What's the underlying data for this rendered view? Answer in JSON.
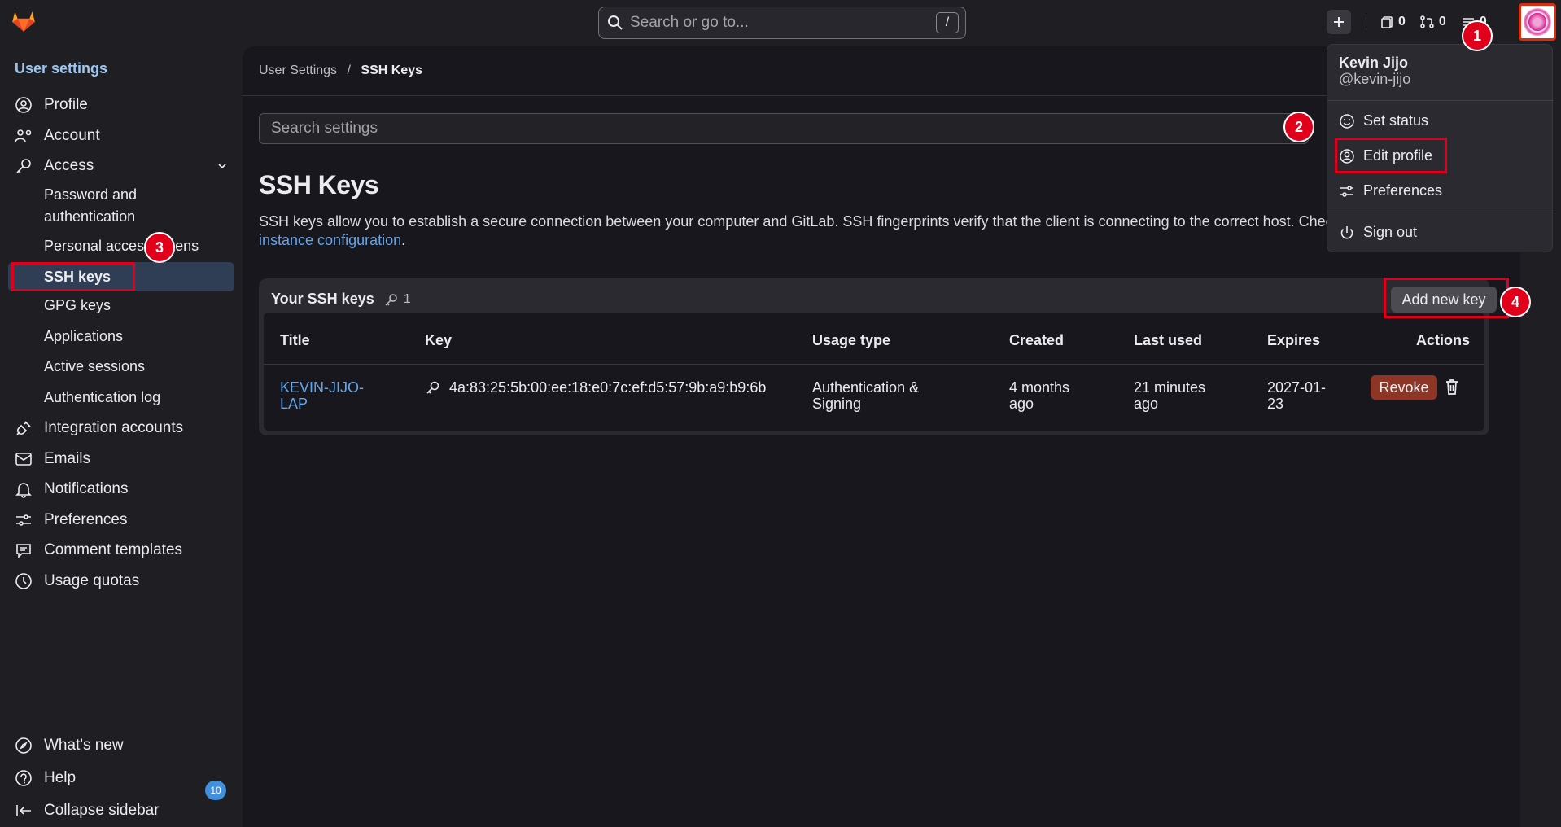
{
  "header": {
    "search_placeholder": "Search or go to...",
    "search_shortcut": "/",
    "issues_count": "0",
    "merge_requests_count": "0",
    "todos_count": "0"
  },
  "sidebar": {
    "title": "User settings",
    "items": [
      {
        "label": "Profile",
        "icon": "profile-icon"
      },
      {
        "label": "Account",
        "icon": "account-icon"
      },
      {
        "label": "Access",
        "icon": "key-icon"
      },
      {
        "label": "Integration accounts",
        "icon": "plug-icon"
      },
      {
        "label": "Emails",
        "icon": "mail-icon"
      },
      {
        "label": "Notifications",
        "icon": "bell-icon"
      },
      {
        "label": "Preferences",
        "icon": "preferences-icon"
      },
      {
        "label": "Comment templates",
        "icon": "comment-icon"
      },
      {
        "label": "Usage quotas",
        "icon": "quota-icon"
      }
    ],
    "access_sub": {
      "password": "Password and authentication",
      "pat": "Personal access tokens",
      "ssh": "SSH keys",
      "gpg": "GPG keys",
      "applications": "Applications",
      "sessions": "Active sessions",
      "auth_log": "Authentication log"
    },
    "footer": {
      "whats_new": "What's new",
      "whats_new_count": "10",
      "help": "Help",
      "collapse": "Collapse sidebar"
    }
  },
  "main": {
    "breadcrumb_parent": "User Settings",
    "breadcrumb_sep": "/",
    "breadcrumb_current": "SSH Keys",
    "search_placeholder": "Search settings",
    "title": "SSH Keys",
    "description": "SSH keys allow you to establish a secure connection between your computer and GitLab. SSH fingerprints verify that the client is connecting to the correct host. Check the current instance configuration.",
    "description_link": "instance configuration",
    "description_end": ".",
    "card": {
      "title": "Your SSH keys",
      "count": "1",
      "add_button": "Add new key",
      "headers": [
        "Title",
        "Key",
        "Usage type",
        "Created",
        "Last used",
        "Expires",
        "Actions"
      ],
      "row": {
        "title_line1": "KEVIN-JIJO-",
        "title_line2": "LAP",
        "key": "4a:83:25:5b:00:ee:18:e0:7c:ef:d5:57:9b:a9:b9:6b",
        "usage_line1": "Authentication &",
        "usage_line2": "Signing",
        "created_line1": "4 months",
        "created_line2": "ago",
        "last_used_line1": "21 minutes",
        "last_used_line2": "ago",
        "expires_line1": "2027-01-",
        "expires_line2": "23",
        "revoke": "Revoke"
      }
    }
  },
  "user_menu": {
    "name": "Kevin Jijo",
    "username": "@kevin-jijo",
    "set_status": "Set status",
    "edit_profile": "Edit profile",
    "preferences": "Preferences",
    "sign_out": "Sign out"
  },
  "annotations": [
    "1",
    "2",
    "3",
    "4"
  ],
  "colors": {
    "accent": "#63a6e9",
    "annotation": "#e0001b",
    "danger": "#8d3625"
  }
}
